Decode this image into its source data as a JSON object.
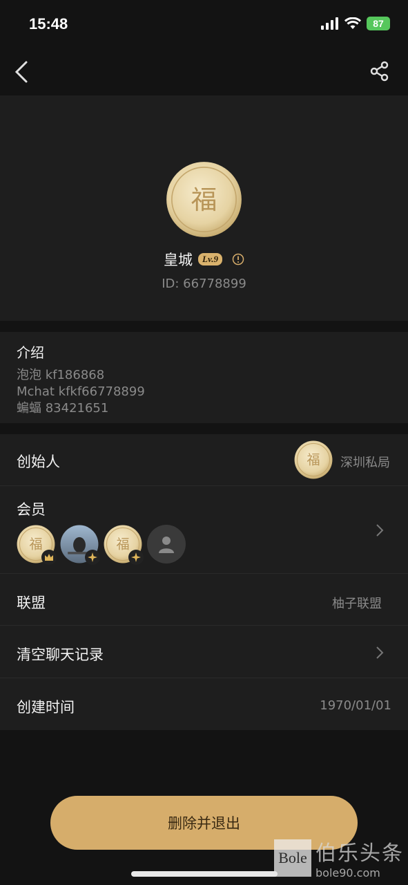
{
  "status": {
    "time": "15:48",
    "battery": "87"
  },
  "nav": {
    "back_icon": "chevron-left-icon",
    "share_icon": "share-icon"
  },
  "profile": {
    "name": "皇城",
    "level_badge": "Lv.9",
    "id_text": "ID: 66778899"
  },
  "intro": {
    "title": "介绍",
    "lines": [
      "泡泡 kf186868",
      "Mchat kfkf66778899",
      "蝙蝠  83421651"
    ]
  },
  "rows": {
    "founder": {
      "label": "创始人",
      "value": "深圳私局"
    },
    "members": {
      "label": "会员"
    },
    "alliance": {
      "label": "联盟",
      "value": "柚子联盟"
    },
    "clear_history": {
      "label": "清空聊天记录"
    },
    "created": {
      "label": "创建时间",
      "value": "1970/01/01"
    }
  },
  "actions": {
    "delete_label": "删除并退出"
  },
  "watermark": {
    "box": "Bole",
    "cn": "伯乐头条",
    "url": "bole90.com"
  },
  "colors": {
    "accent": "#d6ad6b",
    "background": "#131313",
    "card": "#1e1e1e"
  }
}
